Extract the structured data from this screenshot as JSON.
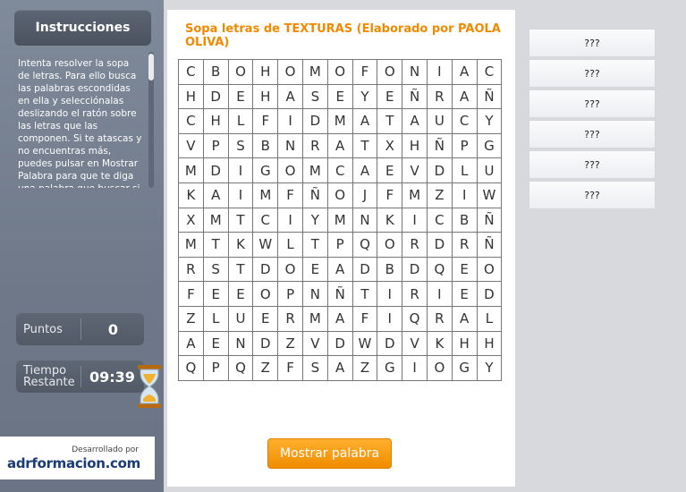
{
  "sidebar": {
    "instructions_title": "Instrucciones",
    "instructions_text": "Intenta resolver la sopa de letras. Para ello busca las palabras escondidas en ella y selecciónalas deslizando el ratón sobre las letras que las componen. Si te atascas y no encuentras más, puedes pulsar en Mostrar Palabra para que te diga una palabra que buscar si",
    "points_label": "Puntos",
    "points_value": "0",
    "time_label": "Tiempo Restante",
    "time_value": "09:39",
    "developed_by": "Desarrollado por",
    "brand": "adrformacion.com"
  },
  "puzzle": {
    "title": "Sopa letras de TEXTURAS (Elaborado por PAOLA OLIVA)",
    "show_word_label": "Mostrar palabra",
    "grid": [
      [
        "C",
        "B",
        "O",
        "H",
        "O",
        "M",
        "O",
        "F",
        "O",
        "N",
        "I",
        "A",
        "C"
      ],
      [
        "H",
        "D",
        "E",
        "H",
        "A",
        "S",
        "E",
        "Y",
        "E",
        "Ñ",
        "R",
        "A",
        "Ñ"
      ],
      [
        "C",
        "H",
        "L",
        "F",
        "I",
        "D",
        "M",
        "A",
        "T",
        "A",
        "U",
        "C",
        "Y"
      ],
      [
        "V",
        "P",
        "S",
        "B",
        "N",
        "R",
        "A",
        "T",
        "X",
        "H",
        "Ñ",
        "P",
        "G"
      ],
      [
        "M",
        "D",
        "I",
        "G",
        "O",
        "M",
        "C",
        "A",
        "E",
        "V",
        "D",
        "L",
        "U"
      ],
      [
        "K",
        "A",
        "I",
        "M",
        "F",
        "Ñ",
        "O",
        "J",
        "F",
        "M",
        "Z",
        "I",
        "W"
      ],
      [
        "X",
        "M",
        "T",
        "C",
        "I",
        "Y",
        "M",
        "N",
        "K",
        "I",
        "C",
        "B",
        "Ñ"
      ],
      [
        "M",
        "T",
        "K",
        "W",
        "L",
        "T",
        "P",
        "Q",
        "O",
        "R",
        "D",
        "R",
        "Ñ"
      ],
      [
        "R",
        "S",
        "T",
        "D",
        "O",
        "E",
        "A",
        "D",
        "B",
        "D",
        "Q",
        "E",
        "O"
      ],
      [
        "F",
        "E",
        "E",
        "O",
        "P",
        "N",
        "Ñ",
        "T",
        "I",
        "R",
        "I",
        "E",
        "D"
      ],
      [
        "Z",
        "L",
        "U",
        "E",
        "R",
        "M",
        "A",
        "F",
        "I",
        "Q",
        "R",
        "A",
        "L"
      ],
      [
        "A",
        "E",
        "N",
        "D",
        "Z",
        "V",
        "D",
        "W",
        "D",
        "V",
        "K",
        "H",
        "H"
      ],
      [
        "Q",
        "P",
        "Q",
        "Z",
        "F",
        "S",
        "A",
        "Z",
        "G",
        "I",
        "O",
        "G",
        "Y"
      ]
    ],
    "hidden_words": [
      "???",
      "???",
      "???",
      "???",
      "???",
      "???"
    ]
  },
  "colors": {
    "accent": "#f08a00",
    "sidebar": "#6e7888"
  }
}
